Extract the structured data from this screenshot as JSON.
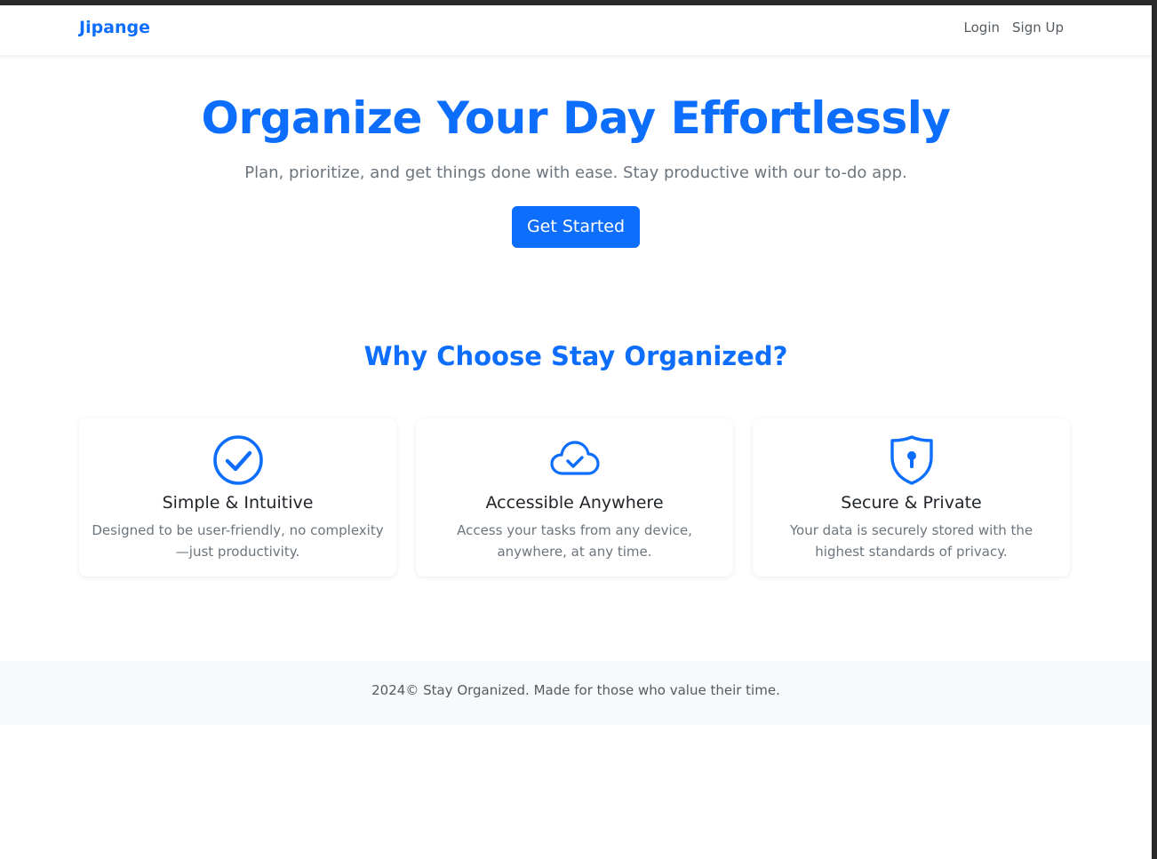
{
  "navbar": {
    "brand": "Jipange",
    "links": [
      "Login",
      "Sign Up"
    ]
  },
  "hero": {
    "title": "Organize Your Day Effortlessly",
    "subtitle": "Plan, prioritize, and get things done with ease. Stay productive with our to-do app.",
    "cta_label": "Get Started"
  },
  "features": {
    "title": "Why Choose Stay Organized?",
    "cards": [
      {
        "icon": "check-circle-icon",
        "title": "Simple & Intuitive",
        "text": "Designed to be user-friendly, no complexity—just productivity."
      },
      {
        "icon": "cloud-check-icon",
        "title": "Accessible Anywhere",
        "text": "Access your tasks from any device, anywhere, at any time."
      },
      {
        "icon": "shield-lock-icon",
        "title": "Secure & Private",
        "text": "Your data is securely stored with the highest standards of privacy."
      }
    ]
  },
  "footer": {
    "text": "2024© Stay Organized. Made for those who value their time."
  },
  "colors": {
    "primary": "#0d6efd",
    "muted": "#6c757d",
    "footer_bg": "#f8f9fa"
  }
}
